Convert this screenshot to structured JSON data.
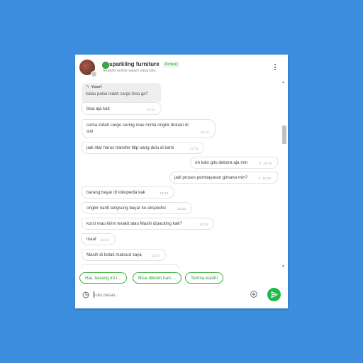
{
  "header": {
    "shop_name": "sparkling furniture",
    "seller_badge": "Penjual",
    "last_online": "Terakhir online sejam yang lalu"
  },
  "reply": {
    "name": "Yosef",
    "text": "kalau pakai indah cargo bisa ga?"
  },
  "messages": [
    {
      "side": "left",
      "text": "bisa aja kak",
      "time": "12:11"
    },
    {
      "side": "left",
      "text": "cuma indah cargo sering mau minta ongkir duluan di",
      "text2": "sini",
      "time": "12:11"
    },
    {
      "side": "left",
      "text": "jadi ntar harus transfer titip uang dulu di kami",
      "time": "12:11"
    },
    {
      "side": "right",
      "text": "oh kalo gitu debora aja min",
      "time": "12:18"
    },
    {
      "side": "right",
      "text": "jadi proses pembayaran gimana min?",
      "time": "12:22"
    },
    {
      "side": "left",
      "text": "barang bayar di tokopedia kak",
      "time": "12:23"
    },
    {
      "side": "left",
      "text": "ongkir nanti langsung bayar ke ekspedisi",
      "time": "12:23"
    },
    {
      "side": "left",
      "text": "kursi mau kirim terakit atau Masih dipacking kak?",
      "time": "12:24"
    },
    {
      "side": "left",
      "text": "maaf",
      "time": "12:24"
    },
    {
      "side": "left",
      "text": "Masih di kotak maksud saya",
      "time": "12:24"
    }
  ],
  "quick_replies": [
    "Hai, barang ini r...",
    "Bisa dikirim hari ...",
    "Terima kasih!"
  ],
  "input": {
    "placeholder": "Tulis pesan..."
  },
  "colors": {
    "accent": "#3fa83c",
    "background": "#3d8ede"
  }
}
